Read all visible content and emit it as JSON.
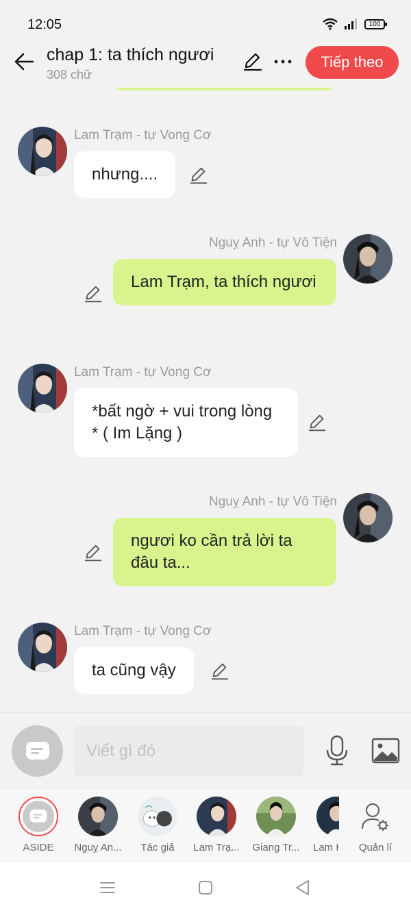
{
  "status": {
    "time": "12:05",
    "battery": "100"
  },
  "header": {
    "title": "chap 1: ta thích ngươi",
    "word_count": "308 chữ",
    "next_label": "Tiếp theo"
  },
  "messages": [
    {
      "side": "left",
      "sender": "Lam Trạm - tự Vong Cơ",
      "text": "nhưng...."
    },
    {
      "side": "right",
      "sender": "Nguỵ Anh - tự Vô Tiện",
      "text": "Lam Trạm, ta thích ngươi"
    },
    {
      "side": "left",
      "sender": "Lam Trạm - tự Vong Cơ",
      "text": "*bất ngờ + vui trong lòng * ( Im Lặng )"
    },
    {
      "side": "right",
      "sender": "Nguỵ Anh - tự Vô Tiện",
      "text": "ngươi ko cần trả lời ta đâu ta..."
    },
    {
      "side": "left",
      "sender": "Lam Trạm - tự Vong Cơ",
      "text": "ta cũng vậy"
    }
  ],
  "input": {
    "placeholder": "Viết gì đó"
  },
  "characters": [
    {
      "name": "ASIDE"
    },
    {
      "name": "Nguỵ An..."
    },
    {
      "name": "Tác giả"
    },
    {
      "name": "Lam Trạ..."
    },
    {
      "name": "Giang Tr..."
    },
    {
      "name": "Lam H"
    },
    {
      "name": "Quản lí"
    }
  ],
  "colors": {
    "accent": "#f04a4d",
    "bubble_right": "#d7f58c",
    "bubble_left": "#ffffff"
  },
  "icons": [
    "back-arrow-icon",
    "pencil-icon",
    "more-icon",
    "microphone-icon",
    "image-icon",
    "chat-bubble-icon",
    "manage-user-icon",
    "menu-icon",
    "home-icon",
    "back-triangle-icon"
  ]
}
